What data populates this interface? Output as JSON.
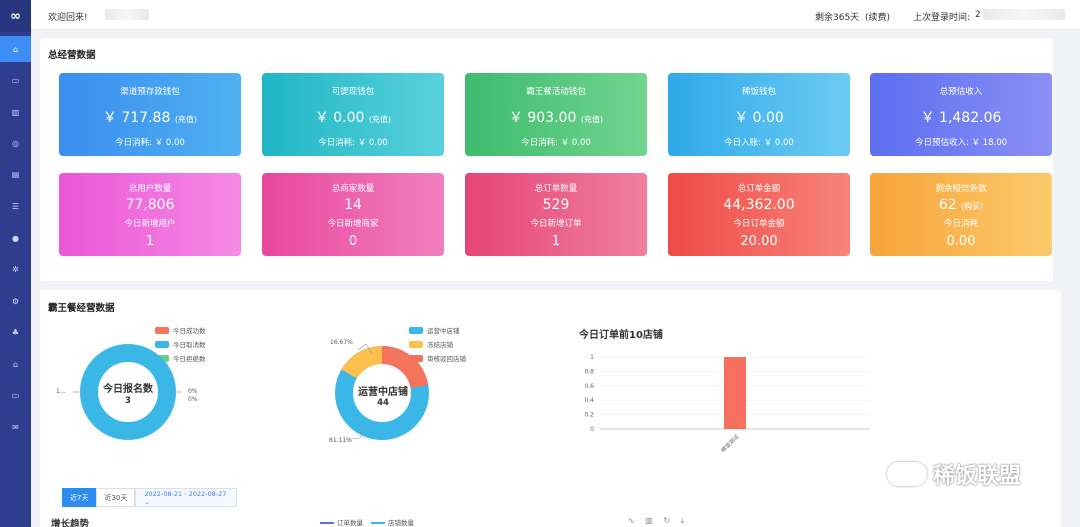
{
  "logo": "∞",
  "nav": [
    "home-icon",
    "monitor-icon",
    "building-icon",
    "circle-icon",
    "store-icon",
    "list-icon",
    "user-icon",
    "gear-icon",
    "settings-icon",
    "team-icon",
    "shop-icon",
    "screen-icon",
    "mail-icon"
  ],
  "topbar": {
    "welcome": "欢迎回来!",
    "remain": "剩余365天",
    "renew": "(续费)",
    "last_login_label": "上次登录时间:",
    "last_login_value": "2"
  },
  "overview": {
    "title": "总经营数据",
    "row1": [
      {
        "title": "渠道预存款钱包",
        "value": "￥ 717.88",
        "unit": "(充值)",
        "sub": "今日消耗:  ￥ 0.00",
        "color1": "#3a8ef0",
        "color2": "#4fb1f1"
      },
      {
        "title": "可提现钱包",
        "value": "￥ 0.00",
        "unit": "(充值)",
        "sub": "今日消耗:  ￥ 0.00",
        "color1": "#1fb6c5",
        "color2": "#5ad1dc"
      },
      {
        "title": "霸王餐活动钱包",
        "value": "￥ 903.00",
        "unit": "(充值)",
        "sub": "今日消耗:  ￥ 0.00",
        "color1": "#3dbc6e",
        "color2": "#72d48f"
      },
      {
        "title": "稀饭钱包",
        "value": "￥ 0.00",
        "unit": "",
        "sub": "今日入账:  ￥ 0.00",
        "color1": "#2fa9e8",
        "color2": "#6ccbf4"
      },
      {
        "title": "总预估收入",
        "value": "￥ 1,482.06",
        "unit": "",
        "sub": "今日预估收入:  ￥ 18.00",
        "color1": "#5b6ff0",
        "color2": "#8a8ff5"
      }
    ],
    "row2": [
      {
        "title": "总用户数量",
        "value": "77,806",
        "unit": "",
        "sub": "今日新增用户",
        "value2": "1",
        "color1": "#ec56d6",
        "color2": "#f48ae6"
      },
      {
        "title": "总商家数量",
        "value": "14",
        "unit": "",
        "sub": "今日新增商家",
        "value2": "0",
        "color1": "#e8479e",
        "color2": "#f27fbf"
      },
      {
        "title": "总订单数量",
        "value": "529",
        "unit": "",
        "sub": "今日新增订单",
        "value2": "1",
        "color1": "#e54576",
        "color2": "#f07fa0"
      },
      {
        "title": "总订单金额",
        "value": "44,362.00",
        "unit": "",
        "sub": "今日订单金额",
        "value2": "20.00",
        "color1": "#f04a46",
        "color2": "#f7847a"
      },
      {
        "title": "剩余短信条数",
        "value": "62",
        "unit": "(购买)",
        "sub": "今日消耗",
        "value2": "0.00",
        "color1": "#f7a43a",
        "color2": "#fbc96b"
      }
    ]
  },
  "bawang": {
    "title": "霸王餐经营数据",
    "donut1": {
      "center_title": "今日报名数",
      "center_value": "3",
      "legend": [
        {
          "label": "今日成功数",
          "color": "#f4735d"
        },
        {
          "label": "今日取消数",
          "color": "#3ab7e6"
        },
        {
          "label": "今日拒绝数",
          "color": "#6bcf7f"
        }
      ],
      "labels": {
        "left": "1...",
        "right1": "0%",
        "right2": "0%"
      }
    },
    "donut2": {
      "center_title": "运营中店铺",
      "center_value": "44",
      "legend": [
        {
          "label": "运营中店铺",
          "color": "#3ab7e6"
        },
        {
          "label": "冻结店铺",
          "color": "#fdbf4e"
        },
        {
          "label": "审核驳回店铺",
          "color": "#f4735d"
        }
      ],
      "labels": {
        "top": "16.67%",
        "bottom": "61.11%"
      }
    },
    "bar_title": "今日订单前10店铺",
    "chart_data": {
      "type": "bar",
      "title": "今日订单前10店铺",
      "categories": [
        "稀饭测试"
      ],
      "values": [
        1
      ],
      "yticks": [
        "0",
        "0.2",
        "0.4",
        "0.6",
        "0.8",
        "1"
      ],
      "ylim": [
        0,
        1
      ],
      "color": "#f76f5e"
    }
  },
  "daterange": {
    "btn1": "近7天",
    "btn2": "近30天",
    "range": "2022-08-21 - 2022-08-27  ⌄"
  },
  "growth": {
    "title": "增长趋势",
    "legend1": "订单数量",
    "legend2": "店铺数量",
    "tools": "∿ ▥ ↻ ⤓"
  },
  "watermark": "稀饭联盟"
}
